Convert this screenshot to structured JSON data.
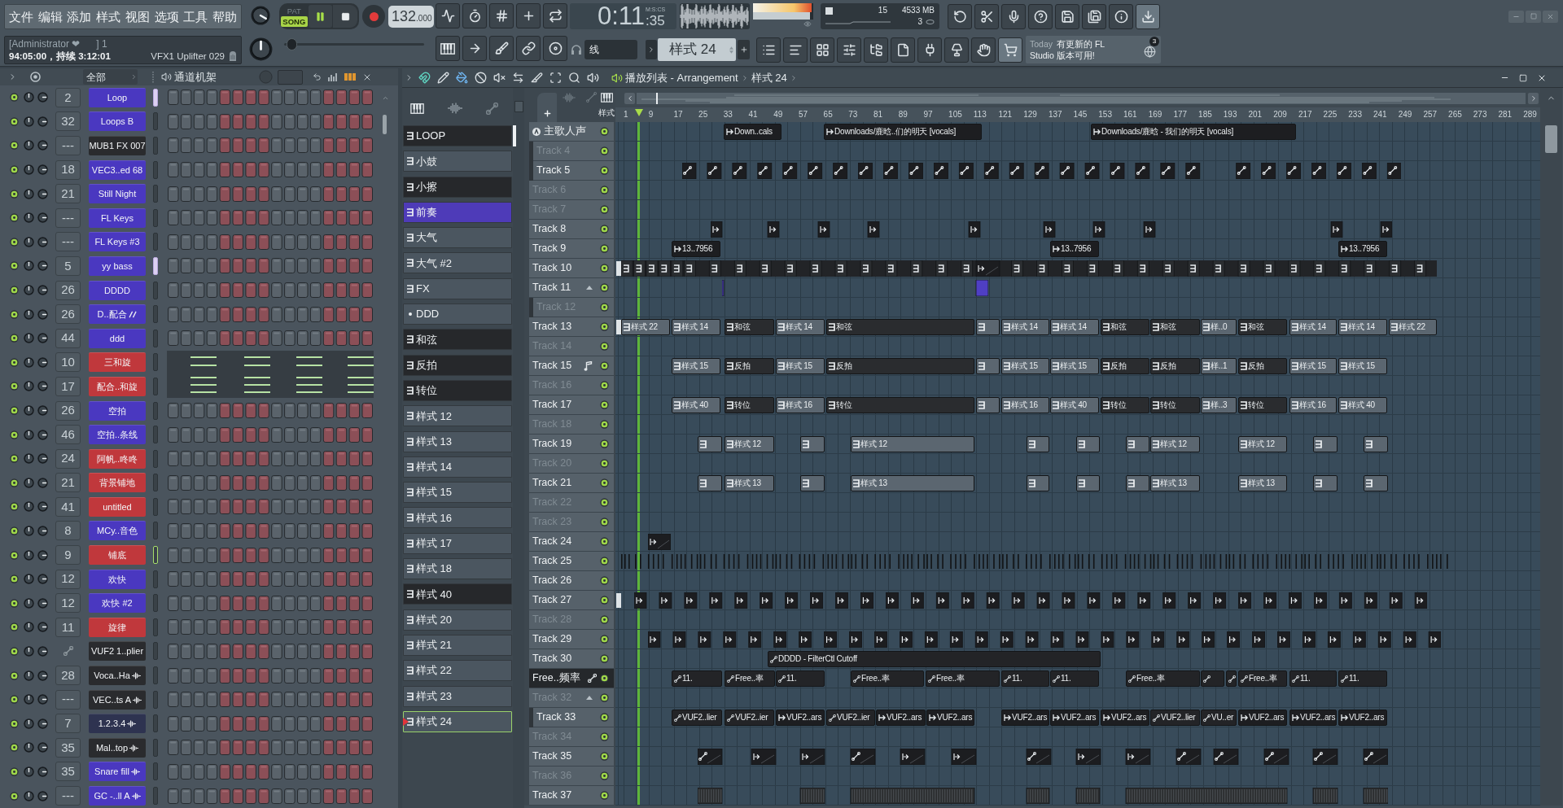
{
  "menu": [
    "文件",
    "编辑",
    "添加",
    "样式",
    "视图",
    "选项",
    "工具",
    "帮助"
  ],
  "hint_bar": {
    "title": "[Administrator ❤      ] 1",
    "text": "94:05:00，持续 3:12:01",
    "detail": "VFX1 Uplifter 029"
  },
  "transport": {
    "modes": [
      {
        "label": "PAT",
        "selected": false
      },
      {
        "label": "SONG",
        "selected": true
      }
    ],
    "playing": true,
    "tempo": "132",
    "tempo_decimals": ".000"
  },
  "song_position": {
    "level": 0.05
  },
  "time": {
    "main": "0:11",
    "sub": ":35",
    "format": "M:S:CS"
  },
  "output_meter": [
    {
      "level": 0.97
    },
    {
      "level": 0.95
    }
  ],
  "monitor": {
    "cpu": "15",
    "memory": "4533 MB",
    "polyphony": "3"
  },
  "snap": {
    "value": "线"
  },
  "pattern_selector": {
    "value": "样式 24"
  },
  "news": {
    "label": "Today",
    "lines": [
      "有更新的 FL",
      "Studio 版本可用!"
    ],
    "badge": "3"
  },
  "channel_rack": {
    "filter": "全部",
    "title": "通道机架",
    "channels": [
      {
        "mixer": "2",
        "name": "Loop",
        "color": "#4a38c0",
        "kind": "sampler",
        "selected": true,
        "focused": false
      },
      {
        "mixer": "32",
        "name": "Loops B",
        "color": "#4a38c0",
        "kind": "sampler",
        "selected": false,
        "focused": false
      },
      {
        "mixer": "---",
        "name": "MUB1 FX 007",
        "color": "#2a2b2e",
        "kind": "sampler",
        "selected": false,
        "focused": false
      },
      {
        "mixer": "18",
        "name": "VEC3..ed 68",
        "color": "#4a38c0",
        "kind": "sampler",
        "selected": false,
        "focused": false
      },
      {
        "mixer": "21",
        "name": "Still Night",
        "color": "#4a38c0",
        "kind": "sampler",
        "selected": false,
        "focused": false
      },
      {
        "mixer": "---",
        "name": "FL Keys",
        "color": "#4a38c0",
        "kind": "sampler",
        "selected": false,
        "focused": false
      },
      {
        "mixer": "---",
        "name": "FL Keys #3",
        "color": "#4a38c0",
        "kind": "sampler",
        "selected": false,
        "focused": false
      },
      {
        "mixer": "5",
        "name": "yy bass",
        "color": "#4a38c0",
        "kind": "sampler",
        "selected": true,
        "focused": false
      },
      {
        "mixer": "26",
        "name": "DDDD",
        "color": "#4a38c0",
        "kind": "sampler",
        "selected": false,
        "focused": false
      },
      {
        "mixer": "26",
        "name": "D..配合",
        "color": "#4a38c0",
        "kind": "slice",
        "selected": false,
        "focused": false
      },
      {
        "mixer": "44",
        "name": "ddd",
        "color": "#4a38c0",
        "kind": "sampler",
        "selected": false,
        "focused": false
      },
      {
        "mixer": "10",
        "name": "三和旋",
        "color": "#c0383c",
        "kind": "pianoroll",
        "selected": false,
        "focused": false
      },
      {
        "mixer": "17",
        "name": "配合..和旋",
        "color": "#c0383c",
        "kind": "pianoroll",
        "selected": false,
        "focused": false
      },
      {
        "mixer": "26",
        "name": "空拍",
        "color": "#4a38c0",
        "kind": "sampler",
        "selected": false,
        "focused": false
      },
      {
        "mixer": "46",
        "name": "空拍..条线",
        "color": "#4a38c0",
        "kind": "sampler",
        "selected": false,
        "focused": false
      },
      {
        "mixer": "24",
        "name": "阿帆..咚咚",
        "color": "#c0383c",
        "kind": "sampler",
        "selected": false,
        "focused": false
      },
      {
        "mixer": "21",
        "name": "背景铺地",
        "color": "#c0383c",
        "kind": "sampler",
        "selected": false,
        "focused": false
      },
      {
        "mixer": "41",
        "name": "untitled",
        "color": "#c0383c",
        "kind": "sampler",
        "selected": false,
        "focused": false
      },
      {
        "mixer": "8",
        "name": "MCy..音色",
        "color": "#4a38c0",
        "kind": "sampler",
        "selected": false,
        "focused": false
      },
      {
        "mixer": "9",
        "name": "铺底",
        "color": "#c0383c",
        "kind": "sampler",
        "selected": false,
        "focused": true
      },
      {
        "mixer": "12",
        "name": "欢快",
        "color": "#4a38c0",
        "kind": "sampler",
        "selected": false,
        "focused": false
      },
      {
        "mixer": "12",
        "name": "欢快 #2",
        "color": "#4a38c0",
        "kind": "sampler",
        "selected": false,
        "focused": false
      },
      {
        "mixer": "11",
        "name": "旋律",
        "color": "#c0383c",
        "kind": "sampler",
        "selected": false,
        "focused": false
      },
      {
        "name": "VUF2 1..plier",
        "color": "#2a2b2e",
        "kind": "automation",
        "selected": false,
        "focused": false
      },
      {
        "mixer": "28",
        "name": "Voca..Ha",
        "color": "#2a2b2e",
        "kind": "audio",
        "selected": false,
        "focused": false
      },
      {
        "mixer": "---",
        "name": "VEC..ts A",
        "color": "#2a2b2e",
        "kind": "audio",
        "selected": false,
        "focused": false
      },
      {
        "mixer": "7",
        "name": "1.2.3.4",
        "color": "#2e3350",
        "kind": "audio",
        "selected": false,
        "focused": false
      },
      {
        "mixer": "35",
        "name": "Mal..top",
        "color": "#2a2b2e",
        "kind": "audio",
        "selected": false,
        "focused": false
      },
      {
        "mixer": "35",
        "name": "Snare fill",
        "color": "#4a38c0",
        "kind": "audio",
        "selected": false,
        "focused": false
      },
      {
        "mixer": "---",
        "name": "GC -..ll A",
        "color": "#4a38c0",
        "kind": "audio",
        "selected": false,
        "focused": false
      }
    ]
  },
  "playlist": {
    "title": "播放列表 - Arrangement",
    "breadcrumb": "样式 24",
    "patterns": [
      {
        "label": "LOOP",
        "kind": "pattern",
        "color": "#26282b",
        "selected": false
      },
      {
        "label": "小鼓",
        "kind": "pattern",
        "color": "#4b5660",
        "selected": false
      },
      {
        "label": "小擦",
        "kind": "pattern",
        "color": "#26282b",
        "selected": false
      },
      {
        "label": "前奏",
        "kind": "pattern",
        "color": "#4e3bb8",
        "selected": false
      },
      {
        "label": "大气",
        "kind": "pattern",
        "color": "#4b5660",
        "selected": false
      },
      {
        "label": "大气 #2",
        "kind": "pattern",
        "color": "#4b5660",
        "selected": false
      },
      {
        "label": "FX",
        "kind": "pattern",
        "color": "#4b5660",
        "selected": false
      },
      {
        "label": "DDD",
        "kind": "empty",
        "color": "#4b5660",
        "selected": false
      },
      {
        "label": "和弦",
        "kind": "pattern",
        "color": "#26282b",
        "selected": false
      },
      {
        "label": "反拍",
        "kind": "pattern",
        "color": "#26282b",
        "selected": false
      },
      {
        "label": "转位",
        "kind": "pattern",
        "color": "#26282b",
        "selected": false
      },
      {
        "label": "样式 12",
        "kind": "pattern",
        "color": "#4b5660",
        "selected": false
      },
      {
        "label": "样式 13",
        "kind": "pattern",
        "color": "#4b5660",
        "selected": false
      },
      {
        "label": "样式 14",
        "kind": "pattern",
        "color": "#4b5660",
        "selected": false
      },
      {
        "label": "样式 15",
        "kind": "pattern",
        "color": "#4b5660",
        "selected": false
      },
      {
        "label": "样式 16",
        "kind": "pattern",
        "color": "#4b5660",
        "selected": false
      },
      {
        "label": "样式 17",
        "kind": "pattern",
        "color": "#4b5660",
        "selected": false
      },
      {
        "label": "样式 18",
        "kind": "pattern",
        "color": "#4b5660",
        "selected": false
      },
      {
        "label": "样式 40",
        "kind": "pattern",
        "color": "#26282b",
        "selected": false
      },
      {
        "label": "样式 20",
        "kind": "pattern",
        "color": "#4b5660",
        "selected": false
      },
      {
        "label": "样式 21",
        "kind": "pattern",
        "color": "#4b5660",
        "selected": false
      },
      {
        "label": "样式 22",
        "kind": "pattern",
        "color": "#4b5660",
        "selected": false
      },
      {
        "label": "样式 23",
        "kind": "pattern",
        "color": "#4b5660",
        "selected": false
      },
      {
        "label": "样式 24",
        "kind": "pattern",
        "color": "#4b5660",
        "selected": true
      }
    ],
    "pattern_filter": {
      "label": "样式"
    },
    "ruler": [
      "1",
      "9",
      "17",
      "25",
      "33",
      "41",
      "49",
      "57",
      "65",
      "73",
      "81",
      "89",
      "97",
      "105",
      "113",
      "121",
      "129",
      "137",
      "145",
      "153",
      "161",
      "169",
      "177",
      "185",
      "193",
      "201",
      "209",
      "217",
      "225",
      "233",
      "241",
      "249",
      "257",
      "265",
      "273",
      "281",
      "289"
    ],
    "tracks": [
      {
        "name": "主歌人声",
        "kind": "vocal",
        "greyed": false,
        "selected": false,
        "clips": [
          {
            "kind": "audio",
            "label": "Down..cals"
          },
          {
            "kind": "audio",
            "label": "Downloads/鹿晗..们的明天 [vocals]"
          },
          {
            "kind": "audio",
            "label": "Downloads/鹿晗 - 我们的明天 [vocals]"
          }
        ],
        "children": [
          {
            "name": "Track 4",
            "greyed": true,
            "selected": false
          },
          {
            "name": "Track 5",
            "greyed": false,
            "selected": false
          }
        ]
      },
      {
        "name": "Track 6",
        "greyed": true,
        "selected": false
      },
      {
        "name": "Track 7",
        "greyed": true,
        "selected": false
      },
      {
        "name": "Track 8",
        "greyed": false,
        "selected": false
      },
      {
        "name": "Track 9",
        "greyed": false,
        "selected": false,
        "clips": [
          {
            "kind": "audio",
            "label": "13..7956"
          },
          {
            "kind": "audio",
            "label": "13..7956"
          },
          {
            "kind": "audio",
            "label": "13..7956"
          }
        ]
      },
      {
        "name": "Track 10",
        "greyed": false,
        "selected": false
      },
      {
        "name": "Track 11",
        "kind": "group",
        "expanded": true,
        "greyed": false,
        "selected": false,
        "children": [
          {
            "name": "Track 12",
            "greyed": true,
            "selected": false
          }
        ]
      },
      {
        "name": "Track 13",
        "greyed": false,
        "selected": false,
        "clips": [
          {
            "kind": "pattern",
            "label": "样式 22",
            "color": "#5b6670"
          },
          {
            "kind": "pattern",
            "label": "样式 14",
            "color": "#5b6670"
          },
          {
            "kind": "pattern",
            "label": "和弦",
            "color": "#2a2c2f"
          },
          {
            "kind": "pattern",
            "label": "样式 14",
            "color": "#5b6670"
          },
          {
            "kind": "pattern",
            "label": "和弦",
            "color": "#2a2c2f"
          },
          {
            "kind": "pattern",
            "color": "#5b6670"
          },
          {
            "kind": "pattern",
            "label": "样式 14",
            "color": "#5b6670"
          },
          {
            "kind": "pattern",
            "label": "样式 14",
            "color": "#5b6670"
          },
          {
            "kind": "pattern",
            "label": "和弦",
            "color": "#2a2c2f"
          },
          {
            "kind": "pattern",
            "label": "和弦",
            "color": "#2a2c2f"
          },
          {
            "kind": "pattern",
            "label": "样..0",
            "color": "#5b6670"
          },
          {
            "kind": "pattern",
            "label": "和弦",
            "color": "#2a2c2f"
          },
          {
            "kind": "pattern",
            "label": "样式 14",
            "color": "#5b6670"
          },
          {
            "kind": "pattern",
            "label": "样式 14",
            "color": "#5b6670"
          },
          {
            "kind": "pattern",
            "label": "样式 22",
            "color": "#5b6670"
          }
        ]
      },
      {
        "name": "Track 14",
        "greyed": true,
        "selected": false
      },
      {
        "name": "Track 15",
        "kind": "note",
        "greyed": false,
        "selected": false,
        "clips": [
          {
            "kind": "pattern",
            "label": "样式 15",
            "color": "#5b6670"
          },
          {
            "kind": "pattern",
            "label": "反拍",
            "color": "#2a2c2f"
          },
          {
            "kind": "pattern",
            "label": "样式 15",
            "color": "#5b6670"
          },
          {
            "kind": "pattern",
            "label": "反拍",
            "color": "#2a2c2f"
          },
          {
            "kind": "pattern",
            "color": "#5b6670"
          },
          {
            "kind": "pattern",
            "label": "样式 15",
            "color": "#5b6670"
          },
          {
            "kind": "pattern",
            "label": "样式 15",
            "color": "#5b6670"
          },
          {
            "kind": "pattern",
            "label": "反拍",
            "color": "#2a2c2f"
          },
          {
            "kind": "pattern",
            "label": "反拍",
            "color": "#2a2c2f"
          },
          {
            "kind": "pattern",
            "label": "样..1",
            "color": "#5b6670"
          },
          {
            "kind": "pattern",
            "label": "反拍",
            "color": "#2a2c2f"
          },
          {
            "kind": "pattern",
            "label": "样式 15",
            "color": "#5b6670"
          },
          {
            "kind": "pattern",
            "label": "样式 15",
            "color": "#5b6670"
          }
        ]
      },
      {
        "name": "Track 16",
        "greyed": true,
        "selected": false
      },
      {
        "name": "Track 17",
        "greyed": false,
        "selected": false,
        "clips": [
          {
            "kind": "pattern",
            "label": "样式 40",
            "color": "#5b6670"
          },
          {
            "kind": "pattern",
            "label": "转位",
            "color": "#2a2c2f"
          },
          {
            "kind": "pattern",
            "label": "样式 16",
            "color": "#5b6670"
          },
          {
            "kind": "pattern",
            "label": "转位",
            "color": "#2a2c2f"
          },
          {
            "kind": "pattern",
            "color": "#5b6670"
          },
          {
            "kind": "pattern",
            "label": "样式 16",
            "color": "#5b6670"
          },
          {
            "kind": "pattern",
            "label": "样式 40",
            "color": "#5b6670"
          },
          {
            "kind": "pattern",
            "label": "转位",
            "color": "#2a2c2f"
          },
          {
            "kind": "pattern",
            "label": "转位",
            "color": "#2a2c2f"
          },
          {
            "kind": "pattern",
            "label": "样..3",
            "color": "#5b6670"
          },
          {
            "kind": "pattern",
            "label": "转位",
            "color": "#2a2c2f"
          },
          {
            "kind": "pattern",
            "label": "样式 16",
            "color": "#5b6670"
          },
          {
            "kind": "pattern",
            "label": "样式 40",
            "color": "#5b6670"
          }
        ]
      },
      {
        "name": "Track 18",
        "greyed": true,
        "selected": false
      },
      {
        "name": "Track 19",
        "greyed": false,
        "selected": false,
        "clips": [
          {
            "kind": "pattern",
            "color": "#5b6670"
          },
          {
            "kind": "pattern",
            "label": "样式 12",
            "color": "#5b6670"
          },
          {
            "kind": "pattern",
            "color": "#5b6670"
          },
          {
            "kind": "pattern",
            "label": "样式 12",
            "color": "#5b6670"
          },
          {
            "kind": "pattern",
            "color": "#5b6670"
          },
          {
            "kind": "pattern",
            "color": "#5b6670"
          },
          {
            "kind": "pattern",
            "color": "#5b6670"
          },
          {
            "kind": "pattern",
            "label": "样式 12",
            "color": "#5b6670"
          },
          {
            "kind": "pattern",
            "label": "样式 12",
            "color": "#5b6670"
          },
          {
            "kind": "pattern",
            "color": "#5b6670"
          },
          {
            "kind": "pattern",
            "color": "#5b6670"
          }
        ]
      },
      {
        "name": "Track 20",
        "greyed": true,
        "selected": false
      },
      {
        "name": "Track 21",
        "greyed": false,
        "selected": false,
        "clips": [
          {
            "kind": "pattern",
            "color": "#5b6670"
          },
          {
            "kind": "pattern",
            "label": "样式 13",
            "color": "#5b6670"
          },
          {
            "kind": "pattern",
            "color": "#5b6670"
          },
          {
            "kind": "pattern",
            "label": "样式 13",
            "color": "#5b6670"
          },
          {
            "kind": "pattern",
            "color": "#5b6670"
          },
          {
            "kind": "pattern",
            "color": "#5b6670"
          },
          {
            "kind": "pattern",
            "color": "#5b6670"
          },
          {
            "kind": "pattern",
            "label": "样式 13",
            "color": "#5b6670"
          },
          {
            "kind": "pattern",
            "label": "样式 13",
            "color": "#5b6670"
          },
          {
            "kind": "pattern",
            "color": "#5b6670"
          },
          {
            "kind": "pattern",
            "color": "#5b6670"
          }
        ]
      },
      {
        "name": "Track 22",
        "greyed": true,
        "selected": false
      },
      {
        "name": "Track 23",
        "greyed": true,
        "selected": false
      },
      {
        "name": "Track 24",
        "greyed": false,
        "selected": false
      },
      {
        "name": "Track 25",
        "greyed": false,
        "selected": false
      },
      {
        "name": "Track 26",
        "greyed": false,
        "selected": false
      },
      {
        "name": "Track 27",
        "greyed": false,
        "selected": false
      },
      {
        "name": "Track 28",
        "greyed": true,
        "selected": false
      },
      {
        "name": "Track 29",
        "greyed": false,
        "selected": false
      },
      {
        "name": "Track 30",
        "greyed": false,
        "selected": false,
        "clips": [
          {
            "kind": "automation",
            "label": "DDDD - FilterCtl Cutoff"
          }
        ]
      },
      {
        "name": "Free..频率",
        "kind": "automation",
        "greyed": false,
        "selected": true,
        "clips": [
          {
            "kind": "automation",
            "label": "11."
          },
          {
            "kind": "automation",
            "label": "Free..率"
          },
          {
            "kind": "automation",
            "label": "11."
          },
          {
            "kind": "automation",
            "label": "Free..率"
          },
          {
            "kind": "automation",
            "label": "Free..率"
          },
          {
            "kind": "automation",
            "label": "11."
          },
          {
            "kind": "automation",
            "label": "11."
          },
          {
            "kind": "automation",
            "label": "Free..率"
          },
          {
            "kind": "automation"
          },
          {
            "kind": "automation"
          },
          {
            "kind": "automation",
            "label": "Free..率"
          },
          {
            "kind": "automation",
            "label": "11."
          },
          {
            "kind": "automation",
            "label": "11."
          }
        ]
      },
      {
        "name": "Track 32",
        "kind": "group",
        "expanded": true,
        "greyed": true,
        "selected": false,
        "children": [
          {
            "name": "Track 33",
            "greyed": false,
            "selected": false,
            "clips": [
              {
                "kind": "automation",
                "label": "VUF2..lier"
              },
              {
                "kind": "automation",
                "label": "VUF2..ier"
              },
              {
                "kind": "audio",
                "label": "VUF2..ars"
              },
              {
                "kind": "automation",
                "label": "VUF2..ier"
              },
              {
                "kind": "audio",
                "label": "VUF2..ars"
              },
              {
                "kind": "audio",
                "label": "VUF2..ars"
              },
              {
                "kind": "audio",
                "label": "VUF2..ars"
              },
              {
                "kind": "audio",
                "label": "VUF2..ars"
              },
              {
                "kind": "audio",
                "label": "VUF2..ars"
              },
              {
                "kind": "automation",
                "label": "VUF2..lier"
              },
              {
                "kind": "automation",
                "label": "VU..er"
              },
              {
                "kind": "audio",
                "label": "VUF2..ars"
              },
              {
                "kind": "audio",
                "label": "VUF2..ars"
              },
              {
                "kind": "audio",
                "label": "VUF2..ars"
              }
            ]
          }
        ]
      },
      {
        "name": "Track 34",
        "greyed": true,
        "selected": false
      },
      {
        "name": "Track 35",
        "greyed": false,
        "selected": false
      },
      {
        "name": "Track 36",
        "greyed": true,
        "selected": false
      },
      {
        "name": "Track 37",
        "greyed": false,
        "selected": false
      }
    ]
  }
}
